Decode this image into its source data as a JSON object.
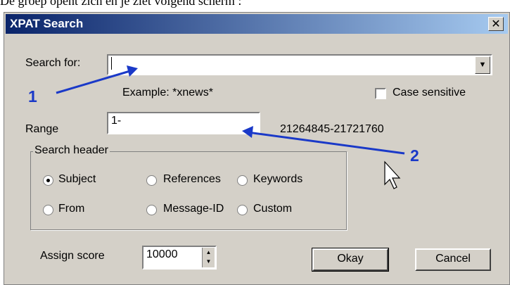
{
  "caption": "De groep opent zich en je ziet volgend scherm :",
  "dialog": {
    "title": "XPAT Search",
    "close_glyph": "✕",
    "search_for_label": "Search for:",
    "search_value": "",
    "example_text": "Example: *xnews*",
    "case_sensitive_label": "Case sensitive",
    "case_sensitive_checked": false,
    "range_label": "Range",
    "range_value": "1-",
    "range_info": "21264845-21721760",
    "search_header": {
      "legend": "Search header",
      "options": [
        {
          "label": "Subject",
          "checked": true
        },
        {
          "label": "References",
          "checked": false
        },
        {
          "label": "Keywords",
          "checked": false
        },
        {
          "label": "From",
          "checked": false
        },
        {
          "label": "Message-ID",
          "checked": false
        },
        {
          "label": "Custom",
          "checked": false
        }
      ]
    },
    "assign_score_label": "Assign score",
    "assign_score_value": "10000",
    "okay_label": "Okay",
    "cancel_label": "Cancel"
  },
  "annotations": {
    "marker_1": "1",
    "marker_2": "2",
    "arrow_color": "#1a39c8"
  },
  "icons": {
    "dropdown": "chevron-down-icon",
    "spin": "spin-arrows-icon",
    "cursor": "mouse-cursor-icon"
  }
}
